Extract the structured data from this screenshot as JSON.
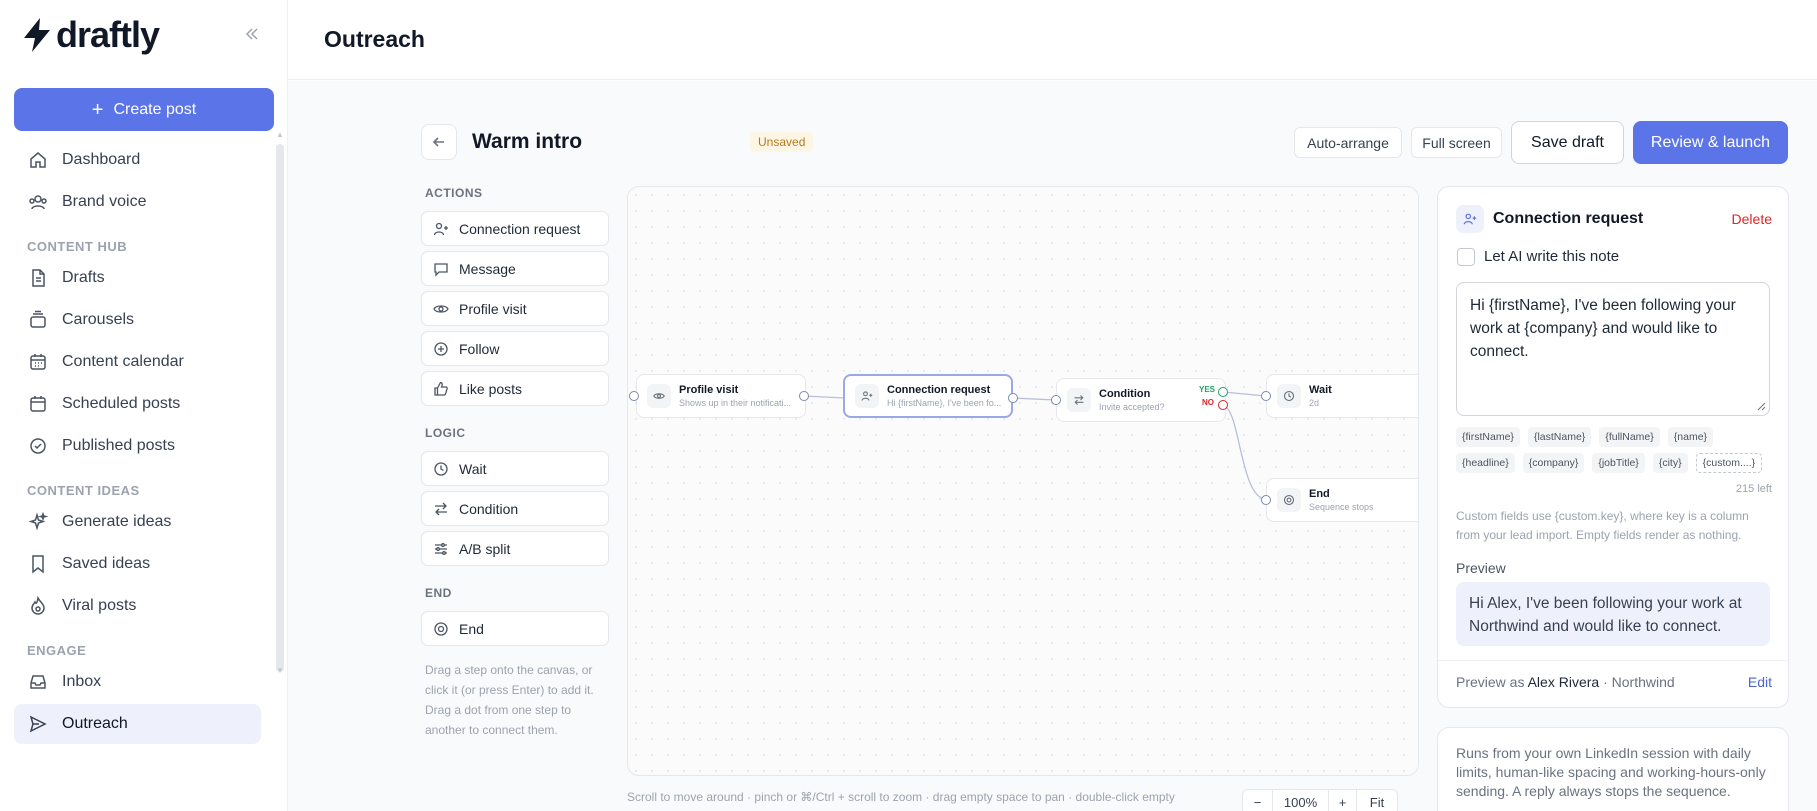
{
  "app": {
    "brand": "draftly",
    "create_post": "Create post",
    "nav": {
      "top": [
        {
          "label": "Dashboard",
          "icon": "home-icon"
        },
        {
          "label": "Brand voice",
          "icon": "users-icon"
        }
      ],
      "content_hub_label": "CONTENT HUB",
      "content_hub": [
        {
          "label": "Drafts",
          "icon": "document-icon"
        },
        {
          "label": "Carousels",
          "icon": "layers-icon"
        },
        {
          "label": "Content calendar",
          "icon": "calendar-icon"
        },
        {
          "label": "Scheduled posts",
          "icon": "calendar-clock-icon"
        },
        {
          "label": "Published posts",
          "icon": "check-circle-icon"
        }
      ],
      "content_ideas_label": "CONTENT IDEAS",
      "content_ideas": [
        {
          "label": "Generate ideas",
          "icon": "sparkles-icon"
        },
        {
          "label": "Saved ideas",
          "icon": "bookmark-icon"
        },
        {
          "label": "Viral posts",
          "icon": "flame-icon"
        }
      ],
      "engage_label": "ENGAGE",
      "engage": [
        {
          "label": "Inbox",
          "icon": "inbox-icon"
        },
        {
          "label": "Outreach",
          "icon": "send-icon",
          "active": true
        }
      ]
    }
  },
  "header": {
    "title": "Outreach"
  },
  "editor": {
    "name": "Warm intro",
    "status": "Unsaved",
    "auto_arrange": "Auto-arrange",
    "full_screen": "Full screen",
    "save_draft": "Save draft",
    "review_launch": "Review & launch"
  },
  "palette": {
    "actions_label": "ACTIONS",
    "actions": [
      "Connection request",
      "Message",
      "Profile visit",
      "Follow",
      "Like posts"
    ],
    "logic_label": "LOGIC",
    "logic": [
      "Wait",
      "Condition",
      "A/B split"
    ],
    "end_label": "END",
    "end": [
      "End"
    ],
    "hint": "Drag a step onto the canvas, or click it (or press Enter) to add it. Drag a dot from one step to another to connect them."
  },
  "canvas": {
    "nodes": {
      "profile_visit": {
        "title": "Profile visit",
        "subtitle": "Shows up in their notificati..."
      },
      "connection_request": {
        "title": "Connection request",
        "subtitle": "Hi {firstName}, I've been fo..."
      },
      "condition": {
        "title": "Condition",
        "subtitle": "Invite accepted?",
        "yes": "YES",
        "no": "NO"
      },
      "wait": {
        "title": "Wait",
        "subtitle": "2d"
      },
      "end": {
        "title": "End",
        "subtitle": "Sequence stops"
      }
    },
    "hint": "Scroll to move around · pinch or ⌘/Ctrl + scroll to zoom · drag empty space to pan · double-click empty",
    "zoom": {
      "minus": "−",
      "level": "100%",
      "plus": "+",
      "fit": "Fit"
    }
  },
  "inspector": {
    "title": "Connection request",
    "delete": "Delete",
    "ai_label": "Let AI write this note",
    "ai_checked": false,
    "note": "Hi {firstName}, I've been following your work at {company} and would like to connect.",
    "tokens": [
      "{firstName}",
      "{lastName}",
      "{fullName}",
      "{name}",
      "{headline}",
      "{company}",
      "{jobTitle}",
      "{city}",
      "{custom....}"
    ],
    "chars_left": "215 left",
    "custom_help": "Custom fields use {custom.key}, where key is a column from your lead import. Empty fields render as nothing.",
    "preview_label": "Preview",
    "preview_text": "Hi Alex, I've been following your work at Northwind and would like to connect.",
    "preview_as_prefix": "Preview as",
    "preview_as_name": "Alex Rivera",
    "preview_as_company": "· Northwind",
    "edit": "Edit"
  },
  "info": {
    "text": "Runs from your own LinkedIn session with daily limits, human-like spacing and working-hours-only sending. A reply always stops the sequence."
  },
  "colors": {
    "accent": "#5b74e8",
    "danger": "#dc2626",
    "yes": "#22a06b",
    "warning": "#b7791f"
  }
}
